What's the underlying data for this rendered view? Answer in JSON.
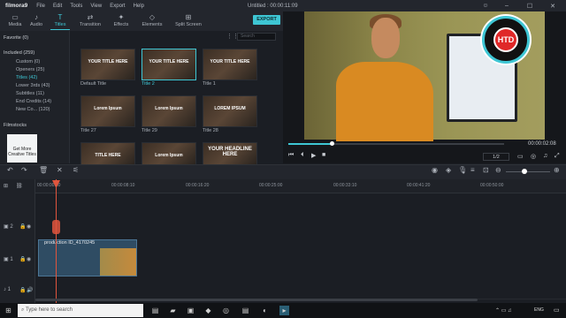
{
  "app": {
    "name": "filmora9",
    "window_title": "Untitled : 00:00:11:09"
  },
  "menu": [
    "File",
    "Edit",
    "Tools",
    "View",
    "Export",
    "Help"
  ],
  "toolbar": {
    "tabs": [
      {
        "label": "Media",
        "icon": "folder-icon"
      },
      {
        "label": "Audio",
        "icon": "music-icon"
      },
      {
        "label": "Titles",
        "icon": "titles-icon",
        "active": true
      },
      {
        "label": "Transition",
        "icon": "transition-icon"
      },
      {
        "label": "Effects",
        "icon": "effects-icon"
      },
      {
        "label": "Elements",
        "icon": "elements-icon"
      },
      {
        "label": "Split Screen",
        "icon": "split-screen-icon"
      }
    ],
    "export_label": "EXPORT"
  },
  "sidebar": {
    "favorite": "Favorite (0)",
    "included": "Included (259)",
    "items": [
      "Custom (0)",
      "Openers (25)",
      "Titles (42)",
      "Lower 3rds (43)",
      "Subtitles (11)",
      "End Credits (14)",
      "New Co... (120)"
    ],
    "selected_index": 2,
    "filmstocks": "Filmstocks",
    "filmstock_promo": "Get More Creative Titles"
  },
  "search": {
    "placeholder": "Search"
  },
  "titles_grid": [
    {
      "caption": "Default Title",
      "overlay": "YOUR TITLE HERE",
      "selected": false
    },
    {
      "caption": "Title 2",
      "overlay": "YOUR TITLE HERE",
      "selected": true
    },
    {
      "caption": "Title 1",
      "overlay": "YOUR TITLE HERE",
      "selected": false
    },
    {
      "caption": "Title 27",
      "overlay": "Lorem Ipsum",
      "selected": false
    },
    {
      "caption": "Title 29",
      "overlay": "Lorem Ipsum",
      "selected": false
    },
    {
      "caption": "Title 28",
      "overlay": "LOREM IPSUM",
      "selected": false
    },
    {
      "caption": "",
      "overlay": "TITLE HERE",
      "selected": false
    },
    {
      "caption": "",
      "overlay": "Lorem Ipsum",
      "selected": false
    },
    {
      "caption": "",
      "overlay": "YOUR HEADLINE HERE",
      "selected": false
    }
  ],
  "preview": {
    "watermark": "HTD",
    "timecode": "00:00:02:08",
    "ratio": "1/2",
    "progress_fraction": 0.2
  },
  "timeline": {
    "ruler": [
      "00:00:00:00",
      "00:00:08:10",
      "00:00:16:20",
      "00:00:25:00",
      "00:00:33:10",
      "00:00:41:20",
      "00:00:50:00"
    ],
    "tracks": [
      {
        "label": "2",
        "type": "video"
      },
      {
        "label": "1",
        "type": "video"
      },
      {
        "label": "1",
        "type": "audio"
      }
    ],
    "clip": {
      "label": "production ID_4170245"
    }
  },
  "taskbar": {
    "search_placeholder": "Type here to search",
    "language": "ENG"
  },
  "colors": {
    "accent": "#3ec6d4",
    "playhead": "#e0553d",
    "clip": "#2f4c63"
  }
}
